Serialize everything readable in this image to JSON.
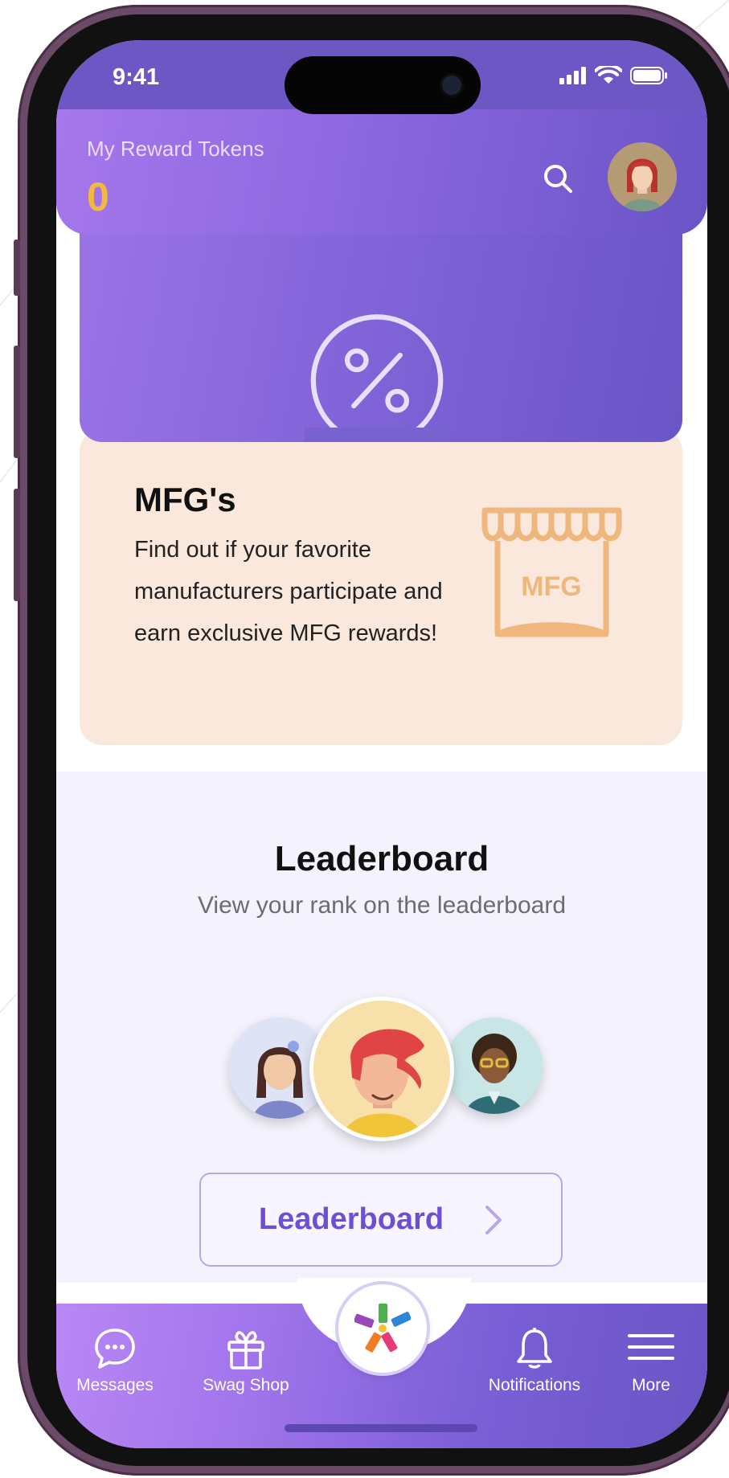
{
  "status_bar": {
    "time": "9:41"
  },
  "header": {
    "tokens_label": "My Reward Tokens",
    "tokens_value": "0"
  },
  "mfg_card": {
    "title": "MFG's",
    "description": "Find out if your favorite manufacturers participate and earn exclusive MFG rewards!",
    "icon_label": "MFG"
  },
  "leaderboard": {
    "title": "Leaderboard",
    "subtitle": "View your rank on the leaderboard",
    "button_label": "Leaderboard"
  },
  "bottom_nav": {
    "items": [
      {
        "label": "Messages",
        "icon": "chat-bubble-icon"
      },
      {
        "label": "Swag Shop",
        "icon": "gift-icon"
      },
      {
        "label": "Notifications",
        "icon": "bell-icon"
      },
      {
        "label": "More",
        "icon": "menu-icon"
      }
    ]
  },
  "colors": {
    "accent": "#6d4fd6",
    "token_gold": "#f3b93c",
    "mfg_card_bg": "#fbe8dc",
    "mfg_icon": "#f0b77c"
  }
}
